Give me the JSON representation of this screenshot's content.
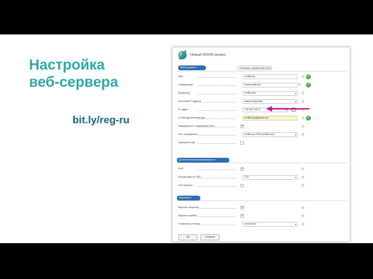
{
  "slide": {
    "title_line1": "Настройка",
    "title_line2": "веб-сервера",
    "link": "bit.ly/reg-ru"
  },
  "screenshot": {
    "window_title": "Новый WWW-домен",
    "tabs": [
      {
        "label": "WWW-домен ▾",
        "active": true
      },
      {
        "label": "Показать справочный текст",
        "active": false
      }
    ],
    "main_rows": [
      {
        "label": "Имя",
        "value": "erofkin.pw",
        "kind": "input",
        "help": true,
        "ok": true
      },
      {
        "label": "Псевдонимы",
        "value": "www.erofkin.pw",
        "kind": "input",
        "help": false,
        "ok": true,
        "search": true
      },
      {
        "label": "Владелец",
        "value": "erofkin-fpa",
        "kind": "select",
        "help": true,
        "ok": false
      },
      {
        "label": "Источник IP-адреса",
        "value": "указать вручную",
        "kind": "select",
        "help": true,
        "ok": false
      },
      {
        "label": "IP-адрес",
        "value": "192.162.240.71",
        "kind": "select",
        "help": true,
        "ok": false,
        "ipicon": true
      },
      {
        "label": "E-Mail администратора",
        "value": "erofkin.fpa@gmail.com",
        "kind": "input-yellow",
        "help": true,
        "ok": true
      },
      {
        "label": "Защищенное соединение (SSL)",
        "value": "",
        "kind": "checkbox-on",
        "help": true,
        "ok": false
      },
      {
        "label": "SSL-сертификат",
        "value": "erofkin.pw-2023 (erofkin.pw)",
        "kind": "select",
        "help": true,
        "ok": false
      },
      {
        "label": "Приоритетный",
        "value": "",
        "kind": "checkbox-off",
        "help": false,
        "ok": false
      }
    ],
    "section2_title": "Дополнительные возможности ▾",
    "section2_rows": [
      {
        "label": "PHP",
        "value": "",
        "kind": "checkbox-on",
        "help": true,
        "ok": false
      },
      {
        "label": "Режим работы PHP",
        "value": "CGI",
        "kind": "select",
        "help": true,
        "ok": false
      },
      {
        "label": "CGI-скрипты",
        "value": "",
        "kind": "checkbox-off",
        "help": true,
        "ok": false
      }
    ],
    "section3_title": "Журналы ▾",
    "section3_rows": [
      {
        "label": "Журнал запросов",
        "value": "",
        "kind": "checkbox-on",
        "help": true,
        "ok": false
      },
      {
        "label": "Журнал ошибок",
        "value": "",
        "kind": "checkbox-on",
        "help": true,
        "ok": false
      },
      {
        "label": "Генератор отчетов",
        "value": "отключено",
        "kind": "select",
        "help": true,
        "ok": false
      }
    ],
    "buttons": {
      "ok": "Ok",
      "cancel": "Отмена"
    }
  },
  "colors": {
    "title": "#2fa7a7",
    "link": "#17657e",
    "tab": "#2f6db0",
    "arrow": "#c2179a",
    "ok": "#3fb04a"
  }
}
